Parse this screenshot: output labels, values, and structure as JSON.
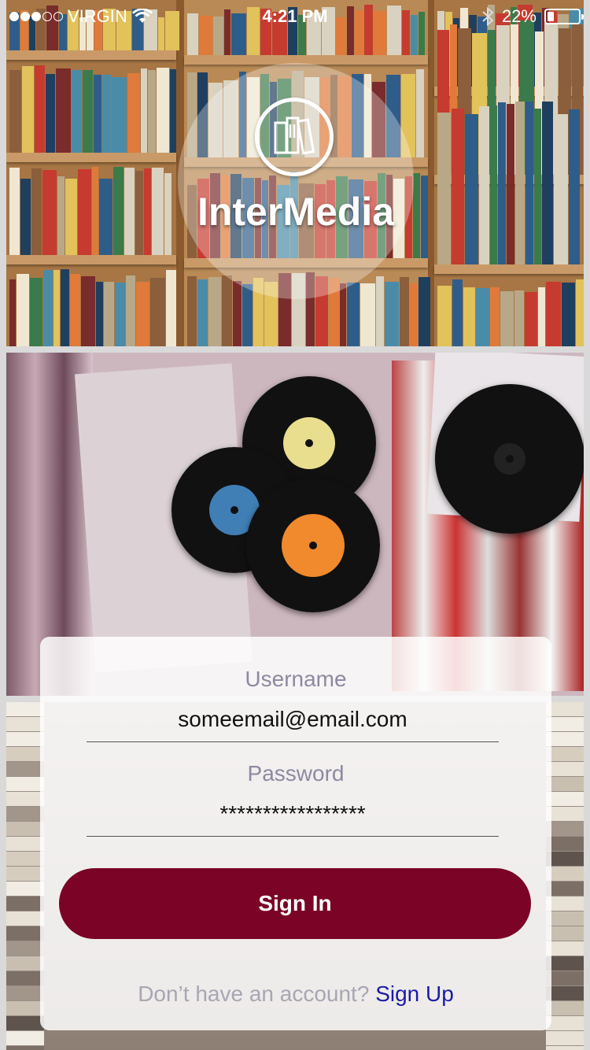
{
  "status_bar": {
    "carrier": "VIRGIN",
    "time": "4:21 PM",
    "battery_text": "22%",
    "battery_level": 0.22,
    "signal_bars": 3,
    "icons": [
      "signal-dots-icon",
      "wifi-icon",
      "bluetooth-icon",
      "battery-icon"
    ]
  },
  "logo": {
    "app_name": "InterMedia",
    "icon": "books-icon"
  },
  "login": {
    "username_label": "Username",
    "username_value": "someemail@email.com",
    "password_label": "Password",
    "password_value": "*****************",
    "signin_label": "Sign In",
    "signup_prompt": "Don’t have an account?",
    "signup_link": "Sign Up"
  },
  "colors": {
    "primary_button": "#7a0326",
    "link": "#1b1ba8",
    "label": "#8e89a0"
  }
}
